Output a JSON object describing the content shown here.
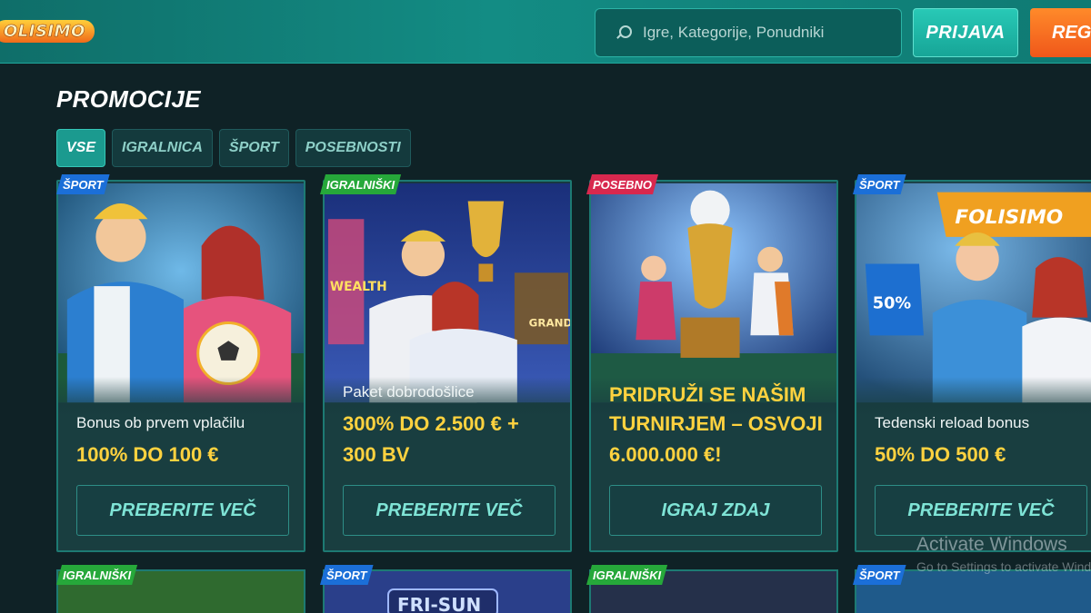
{
  "header": {
    "logo_text": "OLISIMO",
    "search_placeholder": "Igre, Kategorije, Ponudniki",
    "login_label": "PRIJAVA",
    "register_label": "REGIS"
  },
  "page_title": "PROMOCIJE",
  "tabs": [
    {
      "label": "VSE",
      "active": true
    },
    {
      "label": "IGRALNICA",
      "active": false
    },
    {
      "label": "ŠPORT",
      "active": false
    },
    {
      "label": "POSEBNOSTI",
      "active": false
    }
  ],
  "promotions": [
    {
      "badge": "ŠPORT",
      "subtitle": "Bonus ob prvem vplačilu",
      "offer_line1": "100% DO 100 €",
      "offer_line2": "",
      "button": "PREBERITE VEČ"
    },
    {
      "badge": "IGRALNIŠKI",
      "subtitle": "Paket dobrodošlice",
      "offer_line1": "300% DO 2.500 € +",
      "offer_line2": "300 BV",
      "button": "PREBERITE VEČ"
    },
    {
      "badge": "POSEBNO",
      "subtitle": "",
      "offer_line1": "PRIDRUŽI SE NAŠIM",
      "offer_line2": "TURNIRJEM – OSVOJI",
      "offer_line3": "6.000.000 €!",
      "button": "IGRAJ ZDAJ"
    },
    {
      "badge": "ŠPORT",
      "subtitle": "Tedenski reload bonus",
      "offer_line1": "50% DO 500 €",
      "offer_line2": "",
      "button": "PREBERITE VEČ"
    }
  ],
  "second_row_badges": [
    "IGRALNIŠKI",
    "ŠPORT",
    "IGRALNIŠKI",
    "ŠPORT"
  ],
  "image_texts": {
    "card2_sign_left": "WEALTH",
    "card2_sign_right": "GRAND",
    "card4_foam_hand": "50%",
    "card4_banner": "FOLISIMO",
    "row2_card2_banner": "FRI-SUN"
  },
  "watermark": {
    "line1": "Activate Windows",
    "line2": "Go to Settings to activate Windows."
  }
}
